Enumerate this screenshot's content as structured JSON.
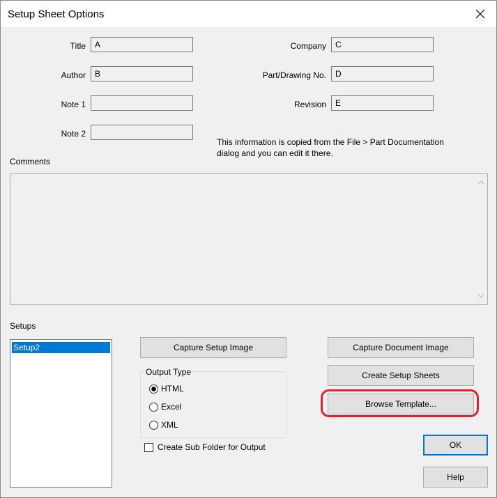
{
  "window": {
    "title": "Setup Sheet Options"
  },
  "fields": {
    "title": {
      "label": "Title",
      "value": "A"
    },
    "author": {
      "label": "Author",
      "value": "B"
    },
    "note1": {
      "label": "Note 1",
      "value": ""
    },
    "note2": {
      "label": "Note 2",
      "value": ""
    },
    "company": {
      "label": "Company",
      "value": "C"
    },
    "part_drawing_no": {
      "label": "Part/Drawing No.",
      "value": "D"
    },
    "revision": {
      "label": "Revision",
      "value": "E"
    }
  },
  "info_text": {
    "line1": "This information is copied from the File > Part Documentation",
    "line2": "dialog and you can edit it there."
  },
  "comments": {
    "label": "Comments",
    "value": ""
  },
  "setups": {
    "label": "Setups",
    "items": [
      "Setup2"
    ]
  },
  "buttons": {
    "capture_setup_image": "Capture Setup Image",
    "capture_document_image": "Capture Document Image",
    "create_setup_sheets": "Create Setup Sheets",
    "browse_template": "Browse Template...",
    "ok": "OK",
    "help": "Help"
  },
  "output_type": {
    "label": "Output Type",
    "options": [
      "HTML",
      "Excel",
      "XML"
    ],
    "selected": "HTML"
  },
  "create_sub_folder": {
    "label": "Create Sub Folder for Output",
    "checked": false
  },
  "colors": {
    "selection": "#0078d7",
    "highlight_annotation": "#e0242b",
    "dialog_background": "#f0f0f0"
  },
  "icons": {
    "close": "close-icon",
    "scroll_up": "chevron-up-icon",
    "scroll_down": "chevron-down-icon"
  }
}
